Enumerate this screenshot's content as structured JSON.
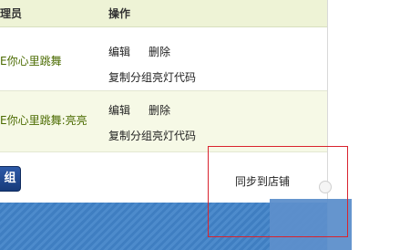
{
  "table": {
    "headers": {
      "admin": "理员",
      "operations": "操作"
    },
    "rows": [
      {
        "admin": "E你心里跳舞",
        "edit": "编辑",
        "delete": "删除",
        "copy": "复制分组亮灯代码"
      },
      {
        "admin": "E你心里跳舞:亮亮",
        "edit": "编辑",
        "delete": "删除",
        "copy": "复制分组亮灯代码"
      }
    ]
  },
  "button": {
    "label": "组"
  },
  "popup": {
    "sync_label": "同步到店铺"
  },
  "colors": {
    "header_bg": "#eef3d6",
    "admin_text": "#4b6b00",
    "highlight_border": "#d9232e",
    "banner_blue": "#3f7ec1"
  }
}
